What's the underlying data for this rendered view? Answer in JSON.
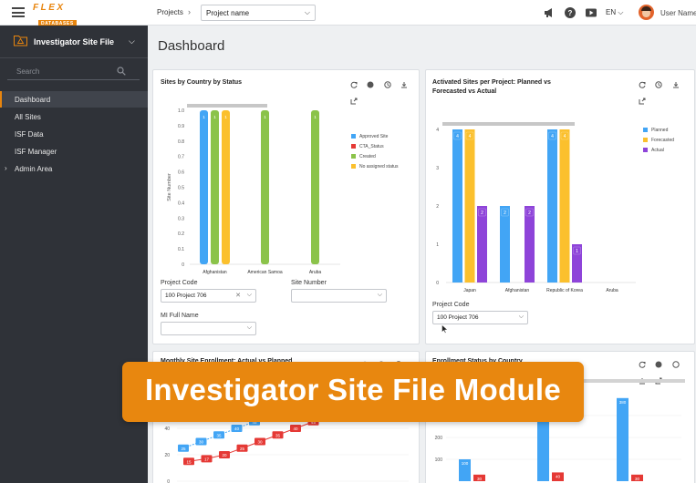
{
  "header": {
    "logo_top": "FLEX",
    "logo_bottom": "DATABASES",
    "breadcrumb": "Projects",
    "breadcrumb_sep": "›",
    "project_value": "Project name",
    "language": "EN",
    "user": "User Name"
  },
  "sidebar": {
    "module_title": "Investigator Site File",
    "search_placeholder": "Search",
    "items": [
      {
        "label": "Dashboard",
        "active": true
      },
      {
        "label": "All Sites",
        "active": false
      },
      {
        "label": "ISF Data",
        "active": false
      },
      {
        "label": "ISF Manager",
        "active": false
      },
      {
        "label": "Admin Area",
        "active": false,
        "expandable": true
      }
    ]
  },
  "page": {
    "title": "Dashboard"
  },
  "card1": {
    "title": "Sites by Country by Status",
    "project_code_label": "Project Code",
    "project_code_value": "100 Project 706",
    "site_number_label": "Site Number",
    "site_number_value": "",
    "mi_label": "MI Full Name",
    "mi_value": ""
  },
  "card2": {
    "title_line1": "Activated Sites per Project: Planned vs",
    "title_line2": "Forecasted vs Actual",
    "project_code_label": "Project Code",
    "project_code_value": "100 Project 706"
  },
  "card3": {
    "title": "Monthly Site Enrollment: Actual vs Planned"
  },
  "card4": {
    "title": "Enrollment Status by Country"
  },
  "banner": {
    "text": "Investigator Site File Module"
  },
  "colors": {
    "accent": "#e8850e",
    "blue": "#42a5f5",
    "green": "#8bc34a",
    "yellow": "#fbc02d",
    "red": "#e53935",
    "purple": "#8e44d9",
    "sidebar": "#2f3238"
  },
  "chart_data": [
    {
      "type": "bar",
      "title": "Sites by Country by Status",
      "ylabel": "Site Number",
      "ylim": [
        0,
        1.0
      ],
      "yticks": [
        "0",
        "0.1",
        "0.2",
        "0.3",
        "0.4",
        "0.5",
        "0.6",
        "0.7",
        "0.8",
        "0.9",
        "1.0"
      ],
      "categories": [
        "Afghanistan",
        "American Samoa",
        "Aruba"
      ],
      "legend": "right",
      "series": [
        {
          "name": "Approved Site",
          "color": "#42a5f5",
          "values": [
            1,
            0,
            0
          ]
        },
        {
          "name": "CTA_Status",
          "color": "#e53935",
          "values": [
            0,
            0,
            0
          ]
        },
        {
          "name": "Created",
          "color": "#8bc34a",
          "values": [
            1,
            1,
            1
          ]
        },
        {
          "name": "No assigned status",
          "color": "#fbc02d",
          "values": [
            1,
            0,
            0
          ]
        }
      ]
    },
    {
      "type": "bar",
      "title": "Activated Sites per Project: Planned vs Forecasted vs Actual",
      "ylim": [
        0,
        4
      ],
      "yticks": [
        "0",
        "1",
        "2",
        "3",
        "4"
      ],
      "categories": [
        "Japan",
        "Afghanistan",
        "Republic of Korea",
        "Aruba"
      ],
      "legend": "right",
      "series": [
        {
          "name": "Planned",
          "color": "#42a5f5",
          "values": [
            4,
            2,
            4,
            0
          ]
        },
        {
          "name": "Forecasted",
          "color": "#fbc02d",
          "values": [
            4,
            0,
            4,
            0
          ]
        },
        {
          "name": "Actual",
          "color": "#8e44d9",
          "values": [
            2,
            2,
            1,
            0
          ]
        }
      ]
    },
    {
      "type": "line",
      "title": "Monthly Site Enrollment: Actual vs Planned",
      "yticks": [
        "40",
        "20",
        "0"
      ],
      "series": [
        {
          "color": "#42a5f5",
          "values": [
            25,
            30,
            35,
            40,
            45,
            50,
            55,
            60
          ]
        },
        {
          "color": "#e53935",
          "values": [
            15,
            17,
            20,
            25,
            30,
            35,
            40,
            45,
            50
          ]
        }
      ]
    },
    {
      "type": "bar",
      "title": "Enrollment Status by Country",
      "yticks": [
        "300",
        "200",
        "100"
      ],
      "series": [
        {
          "color": "#42a5f5",
          "values": [
            100,
            390,
            380
          ]
        },
        {
          "color": "#e53935",
          "values": [
            30,
            40,
            30
          ]
        }
      ]
    }
  ]
}
